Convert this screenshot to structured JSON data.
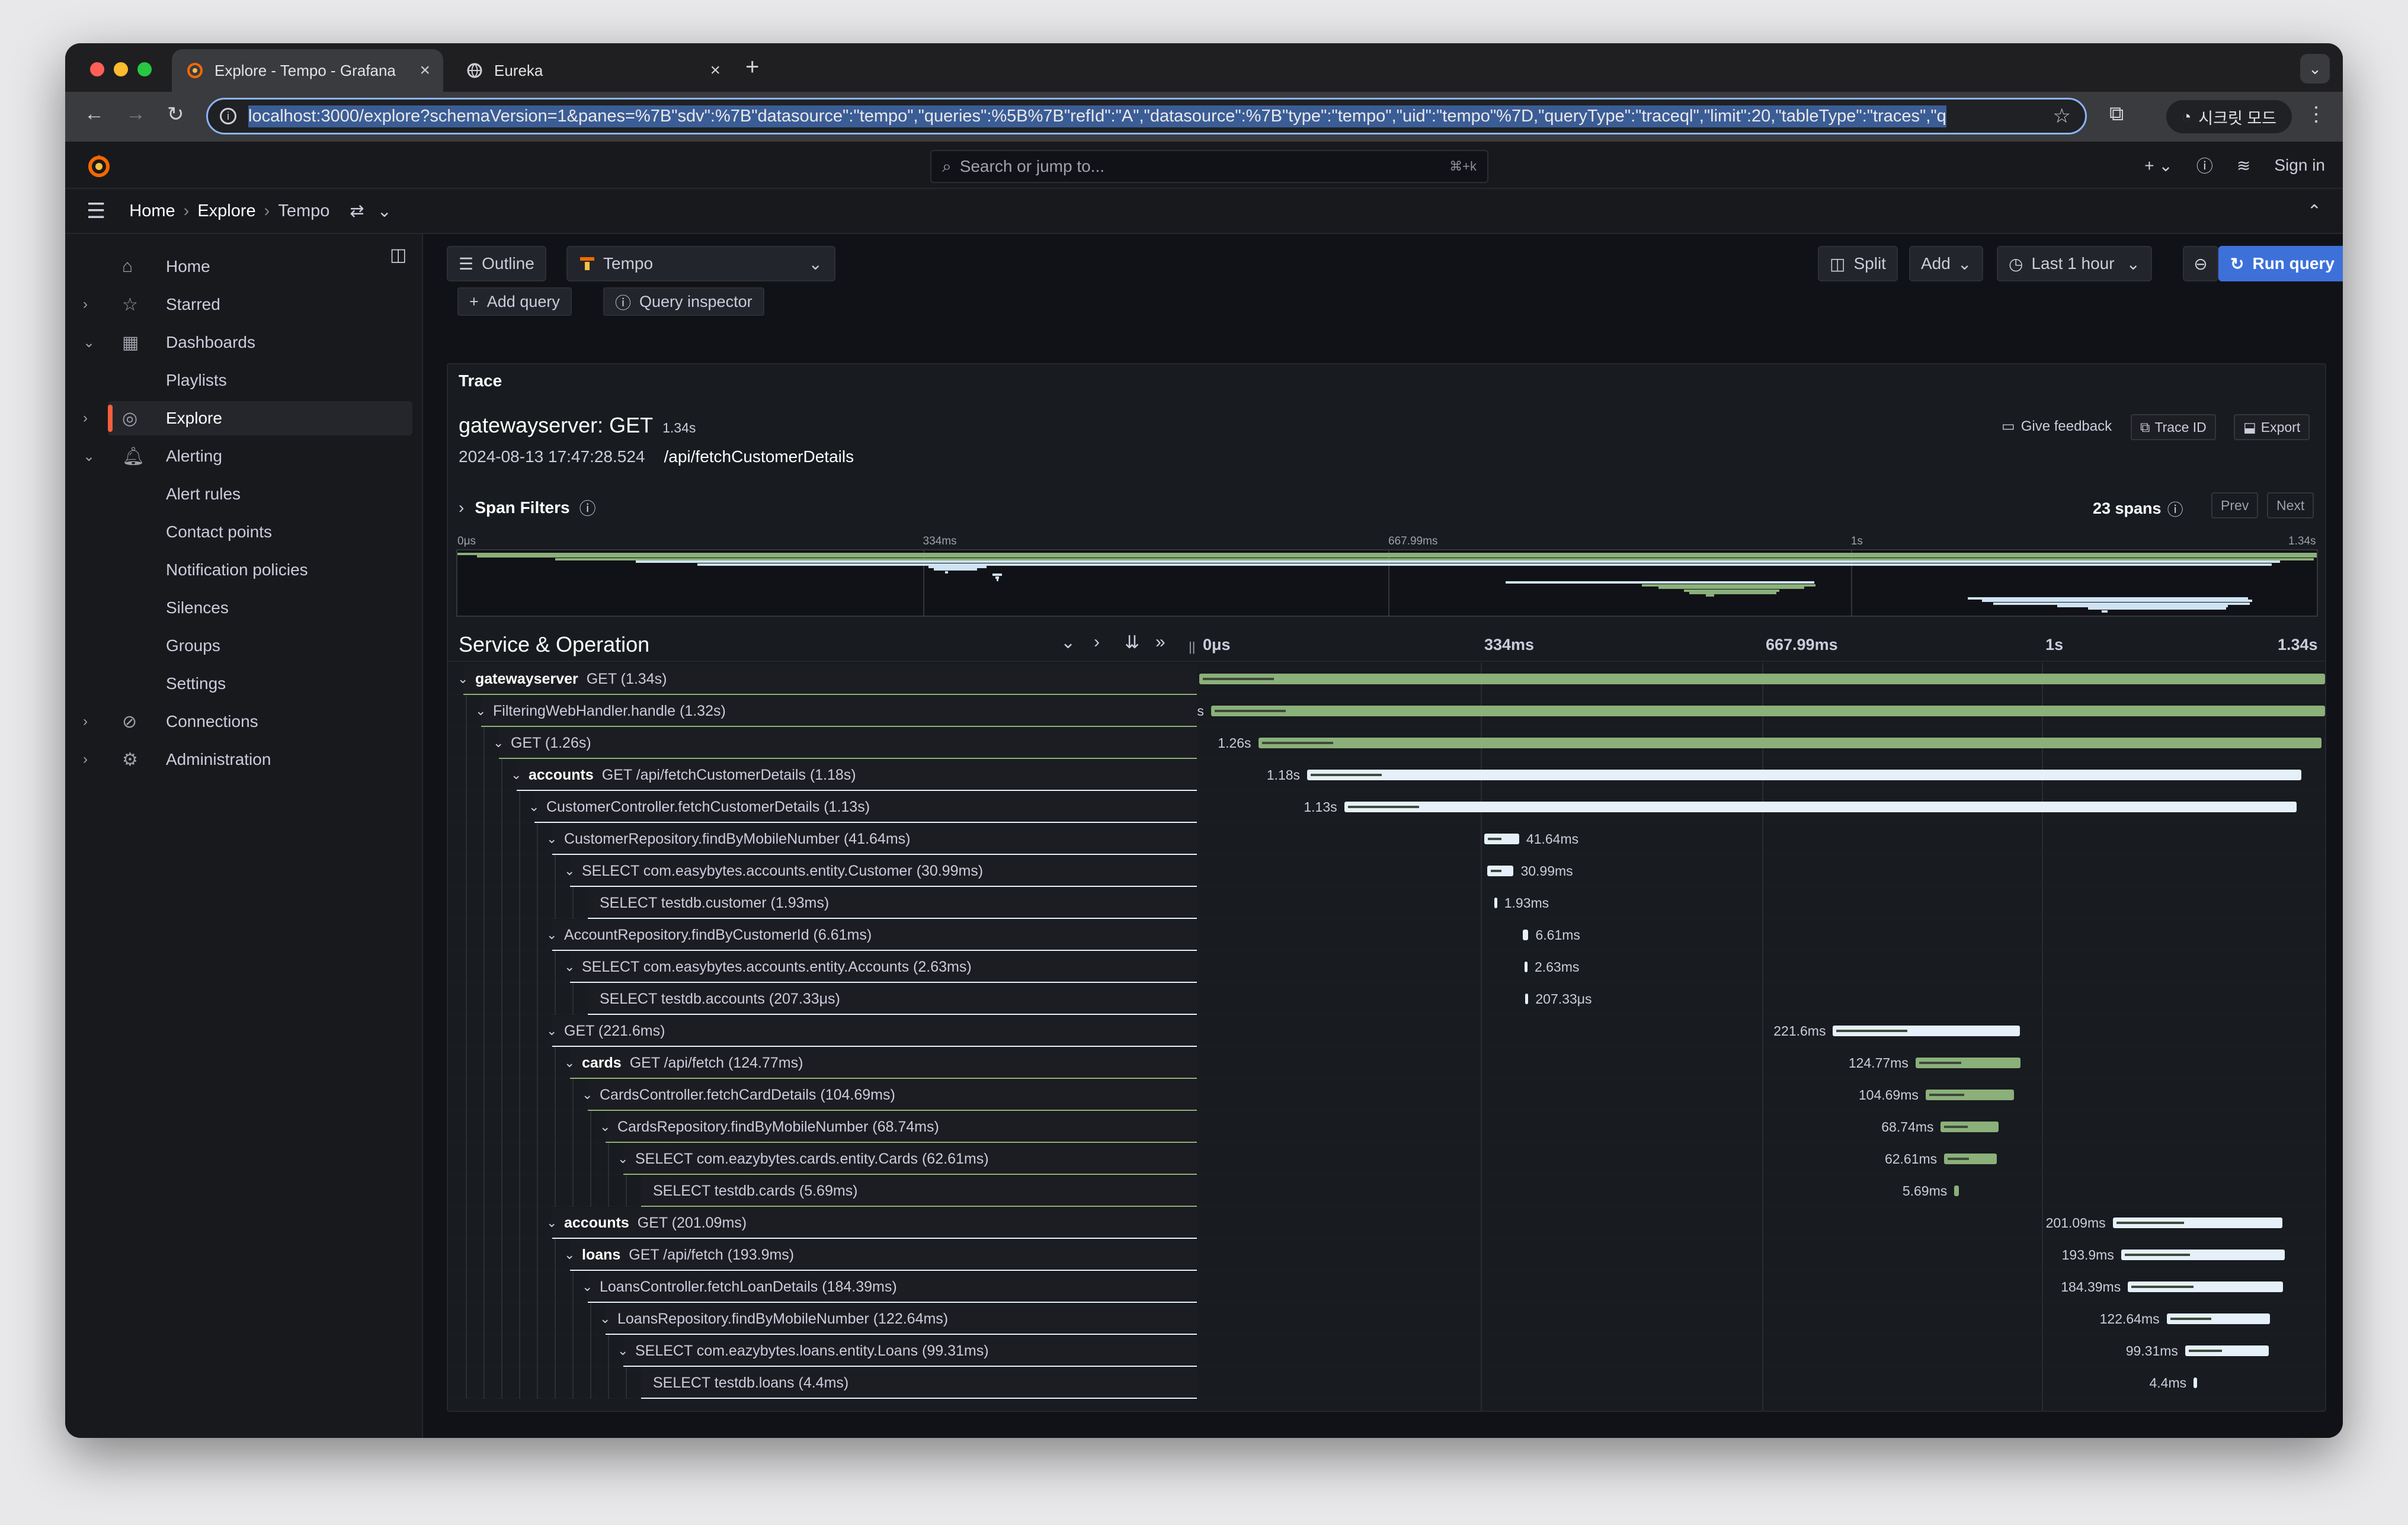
{
  "browser": {
    "tabs": [
      {
        "title": "Explore - Tempo - Grafana",
        "active": true
      },
      {
        "title": "Eureka",
        "active": false
      }
    ],
    "url": "localhost:3000/explore?schemaVersion=1&panes=%7B\"sdv\":%7B\"datasource\":\"tempo\",\"queries\":%5B%7B\"refId\":\"A\",\"datasource\":%7B\"type\":\"tempo\",\"uid\":\"tempo\"%7D,\"queryType\":\"traceql\",\"limit\":20,\"tableType\":\"traces\",\"q",
    "incognito_label": "시크릿 모드"
  },
  "grafana": {
    "search_placeholder": "Search or jump to...",
    "search_shortcut": "⌘+k",
    "sign_in": "Sign in",
    "breadcrumb": [
      "Home",
      "Explore",
      "Tempo"
    ]
  },
  "sidebar": {
    "items": [
      {
        "label": "Home",
        "icon": "home-icon",
        "chevron": ""
      },
      {
        "label": "Starred",
        "icon": "star-icon",
        "chevron": "›"
      },
      {
        "label": "Dashboards",
        "icon": "grid-icon",
        "chevron": "⌄"
      },
      {
        "label": "Playlists",
        "icon": "",
        "chevron": ""
      },
      {
        "label": "Explore",
        "icon": "compass-icon",
        "chevron": "›"
      },
      {
        "label": "Alerting",
        "icon": "bell-icon",
        "chevron": "⌄"
      },
      {
        "label": "Alert rules",
        "icon": "",
        "chevron": ""
      },
      {
        "label": "Contact points",
        "icon": "",
        "chevron": ""
      },
      {
        "label": "Notification policies",
        "icon": "",
        "chevron": ""
      },
      {
        "label": "Silences",
        "icon": "",
        "chevron": ""
      },
      {
        "label": "Groups",
        "icon": "",
        "chevron": ""
      },
      {
        "label": "Settings",
        "icon": "",
        "chevron": ""
      },
      {
        "label": "Connections",
        "icon": "plug-icon",
        "chevron": "›"
      },
      {
        "label": "Administration",
        "icon": "gear-icon",
        "chevron": "›"
      }
    ]
  },
  "toolbar": {
    "outline": "Outline",
    "datasource": "Tempo",
    "split": "Split",
    "add": "Add",
    "time_range": "Last 1 hour",
    "run_query": "Run query",
    "add_query": "Add query",
    "query_inspector": "Query inspector"
  },
  "trace": {
    "panel_title": "Trace",
    "service": "gatewayserver: GET",
    "duration": "1.34s",
    "start_time": "2024-08-13 17:47:28.524",
    "url_path": "/api/fetchCustomerDetails",
    "give_feedback": "Give feedback",
    "trace_id_btn": "Trace ID",
    "export_btn": "Export",
    "span_filters": "Span Filters",
    "span_count": "23 spans",
    "prev": "Prev",
    "next": "Next",
    "minimap_ticks": [
      "0μs",
      "334ms",
      "667.99ms",
      "1s",
      "1.34s"
    ],
    "header_title": "Service & Operation",
    "timeline_ticks": [
      "0μs",
      "334ms",
      "667.99ms",
      "1s",
      "1.34s"
    ],
    "total_ms": 1336,
    "spans": [
      {
        "depth": 0,
        "service": "gatewayserver",
        "op": "GET (1.34s)",
        "start": 0,
        "dur": 1336,
        "color": "green",
        "label": ""
      },
      {
        "depth": 1,
        "service": "",
        "op": "FilteringWebHandler.handle (1.32s)",
        "start": 14,
        "dur": 1322,
        "color": "green",
        "label": "s"
      },
      {
        "depth": 2,
        "service": "",
        "op": "GET (1.26s)",
        "start": 70,
        "dur": 1262,
        "color": "green",
        "label": "1.26s"
      },
      {
        "depth": 3,
        "service": "accounts",
        "op": "GET /api/fetchCustomerDetails (1.18s)",
        "start": 128,
        "dur": 1180,
        "color": "white",
        "label": "1.18s"
      },
      {
        "depth": 4,
        "service": "",
        "op": "CustomerController.fetchCustomerDetails (1.13s)",
        "start": 172,
        "dur": 1130,
        "color": "white",
        "label": "1.13s"
      },
      {
        "depth": 5,
        "service": "",
        "op": "CustomerRepository.findByMobileNumber (41.64ms)",
        "start": 338,
        "dur": 41.64,
        "color": "white",
        "label": "41.64ms"
      },
      {
        "depth": 6,
        "service": "",
        "op": "SELECT com.easybytes.accounts.entity.Customer (30.99ms)",
        "start": 342,
        "dur": 30.99,
        "color": "white",
        "label": "30.99ms"
      },
      {
        "depth": 7,
        "service": "",
        "op": "SELECT testdb.customer (1.93ms)",
        "start": 350,
        "dur": 1.93,
        "color": "white",
        "label": "1.93ms"
      },
      {
        "depth": 5,
        "service": "",
        "op": "AccountRepository.findByCustomerId (6.61ms)",
        "start": 384,
        "dur": 6.61,
        "color": "white",
        "label": "6.61ms"
      },
      {
        "depth": 6,
        "service": "",
        "op": "SELECT com.easybytes.accounts.entity.Accounts (2.63ms)",
        "start": 386,
        "dur": 2.63,
        "color": "white",
        "label": "2.63ms"
      },
      {
        "depth": 7,
        "service": "",
        "op": "SELECT testdb.accounts (207.33μs)",
        "start": 387,
        "dur": 0.21,
        "color": "white",
        "label": "207.33μs"
      },
      {
        "depth": 5,
        "service": "",
        "op": "GET (221.6ms)",
        "start": 752,
        "dur": 221.6,
        "color": "white",
        "label": "221.6ms"
      },
      {
        "depth": 6,
        "service": "cards",
        "op": "GET /api/fetch (124.77ms)",
        "start": 850,
        "dur": 124.77,
        "color": "green",
        "label": "124.77ms"
      },
      {
        "depth": 7,
        "service": "",
        "op": "CardsController.fetchCardDetails (104.69ms)",
        "start": 862,
        "dur": 104.69,
        "color": "green",
        "label": "104.69ms"
      },
      {
        "depth": 8,
        "service": "",
        "op": "CardsRepository.findByMobileNumber (68.74ms)",
        "start": 880,
        "dur": 68.74,
        "color": "green",
        "label": "68.74ms"
      },
      {
        "depth": 9,
        "service": "",
        "op": "SELECT com.eazybytes.cards.entity.Cards (62.61ms)",
        "start": 884,
        "dur": 62.61,
        "color": "green",
        "label": "62.61ms"
      },
      {
        "depth": 10,
        "service": "",
        "op": "SELECT testdb.cards (5.69ms)",
        "start": 896,
        "dur": 5.69,
        "color": "green",
        "label": "5.69ms"
      },
      {
        "depth": 5,
        "service": "accounts",
        "op": "GET (201.09ms)",
        "start": 1084,
        "dur": 201.09,
        "color": "white",
        "label": "201.09ms"
      },
      {
        "depth": 6,
        "service": "loans",
        "op": "GET /api/fetch (193.9ms)",
        "start": 1094,
        "dur": 193.9,
        "color": "white",
        "label": "193.9ms"
      },
      {
        "depth": 7,
        "service": "",
        "op": "LoansController.fetchLoanDetails (184.39ms)",
        "start": 1102,
        "dur": 184.39,
        "color": "white",
        "label": "184.39ms"
      },
      {
        "depth": 8,
        "service": "",
        "op": "LoansRepository.findByMobileNumber (122.64ms)",
        "start": 1148,
        "dur": 122.64,
        "color": "white",
        "label": "122.64ms"
      },
      {
        "depth": 9,
        "service": "",
        "op": "SELECT com.eazybytes.loans.entity.Loans (99.31ms)",
        "start": 1170,
        "dur": 99.31,
        "color": "white",
        "label": "99.31ms"
      },
      {
        "depth": 10,
        "service": "",
        "op": "SELECT testdb.loans (4.4ms)",
        "start": 1180,
        "dur": 4.4,
        "color": "white",
        "label": "4.4ms"
      }
    ]
  }
}
